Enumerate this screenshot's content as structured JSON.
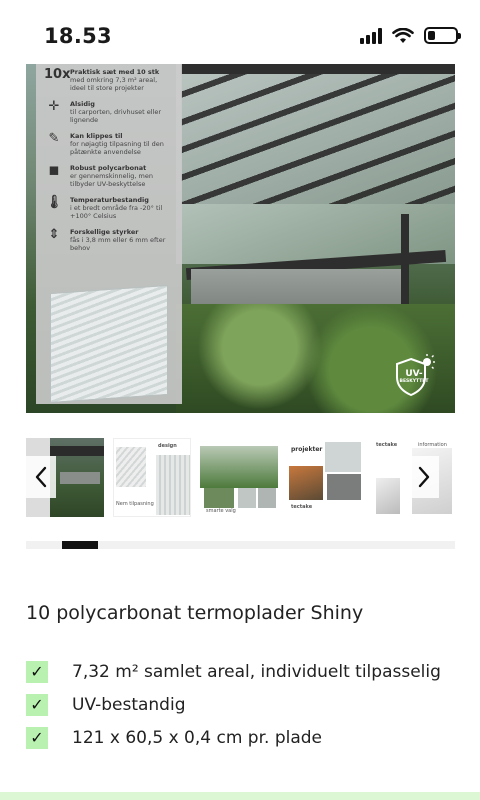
{
  "status_bar": {
    "time": "18.53",
    "battery_level": 0.25
  },
  "hero": {
    "features": [
      {
        "icon": "10x",
        "title": "Praktisk sæt med 10 stk",
        "text": "med omkring 7,3 m² areal, ideel til store projekter"
      },
      {
        "icon": "move-arrows-icon",
        "title": "Alsidig",
        "text": "til carporten, drivhuset eller lignende"
      },
      {
        "icon": "cut-icon",
        "title": "Kan klippes til",
        "text": "for nøjagtig tilpasning til den påtænkte anvendelse"
      },
      {
        "icon": "strong-arm-icon",
        "title": "Robust polycarbonat",
        "text": "er gennemskinnelig, men tilbyder UV-beskyttelse"
      },
      {
        "icon": "thermometer-icon",
        "title": "Temperaturbestandig",
        "text": "i et bredt område fra -20° til +100° Celsius"
      },
      {
        "icon": "thickness-icon",
        "title": "Forskellige styrker",
        "text": "fås i 3,8 mm eller 6 mm efter behov"
      }
    ],
    "uv_badge": {
      "main": "UV-",
      "sub": "BESKYTTET"
    }
  },
  "thumbnails": {
    "t2_label_top": "design",
    "t2_label_bottom": "Nem tilpasning",
    "t3_label": "smarte valg",
    "t4_top": "projekter",
    "t4_brand": "tectake",
    "t5_brand": "tectake",
    "t5_label": "information",
    "prev_icon": "chevron-left-icon",
    "next_icon": "chevron-right-icon"
  },
  "carousel_progress": {
    "current": 2,
    "total": 12
  },
  "product": {
    "title": "10 polycarbonat termoplader Shiny",
    "features": [
      "7,32 m² samlet areal, individuelt tilpasselig",
      "UV-bestandig",
      "121 x 60,5 x 0,4 cm pr. plade"
    ]
  },
  "colors": {
    "check_bg": "#b9f2b0",
    "progress_fill": "#111111",
    "footer_strip": "#dbf7d4"
  }
}
